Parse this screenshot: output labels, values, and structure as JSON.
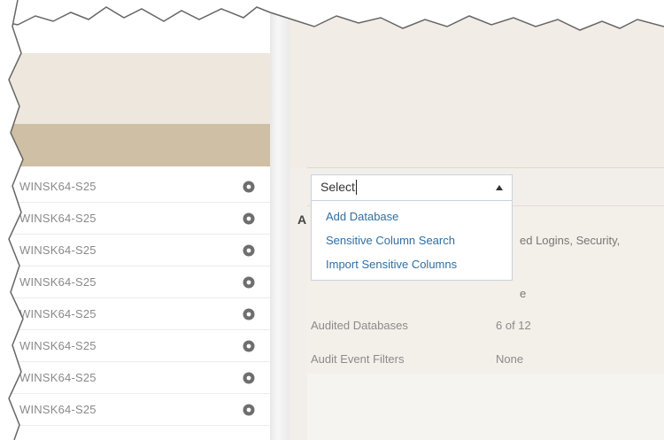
{
  "servers": [
    {
      "name": "WINSK64-S25"
    },
    {
      "name": "WINSK64-S25"
    },
    {
      "name": "WINSK64-S25"
    },
    {
      "name": "WINSK64-S25"
    },
    {
      "name": "WINSK64-S25"
    },
    {
      "name": "WINSK64-S25"
    },
    {
      "name": "WINSK64-S25"
    },
    {
      "name": "WINSK64-S25"
    }
  ],
  "select": {
    "value": "Select",
    "options": [
      "Add Database",
      "Sensitive Column Search",
      "Import Sensitive Columns"
    ]
  },
  "fragments": {
    "heading_initial": "A",
    "logins_text": "ed Logins, Security,",
    "partial_value": "e"
  },
  "details": [
    {
      "label": "Audited Databases",
      "value": "6 of 12"
    },
    {
      "label": "Audit Event Filters",
      "value": "None"
    }
  ],
  "colors": {
    "left_header_light": "#ede7dd",
    "left_header_dark": "#cfbfa4",
    "link_blue": "#2f6fa3"
  }
}
